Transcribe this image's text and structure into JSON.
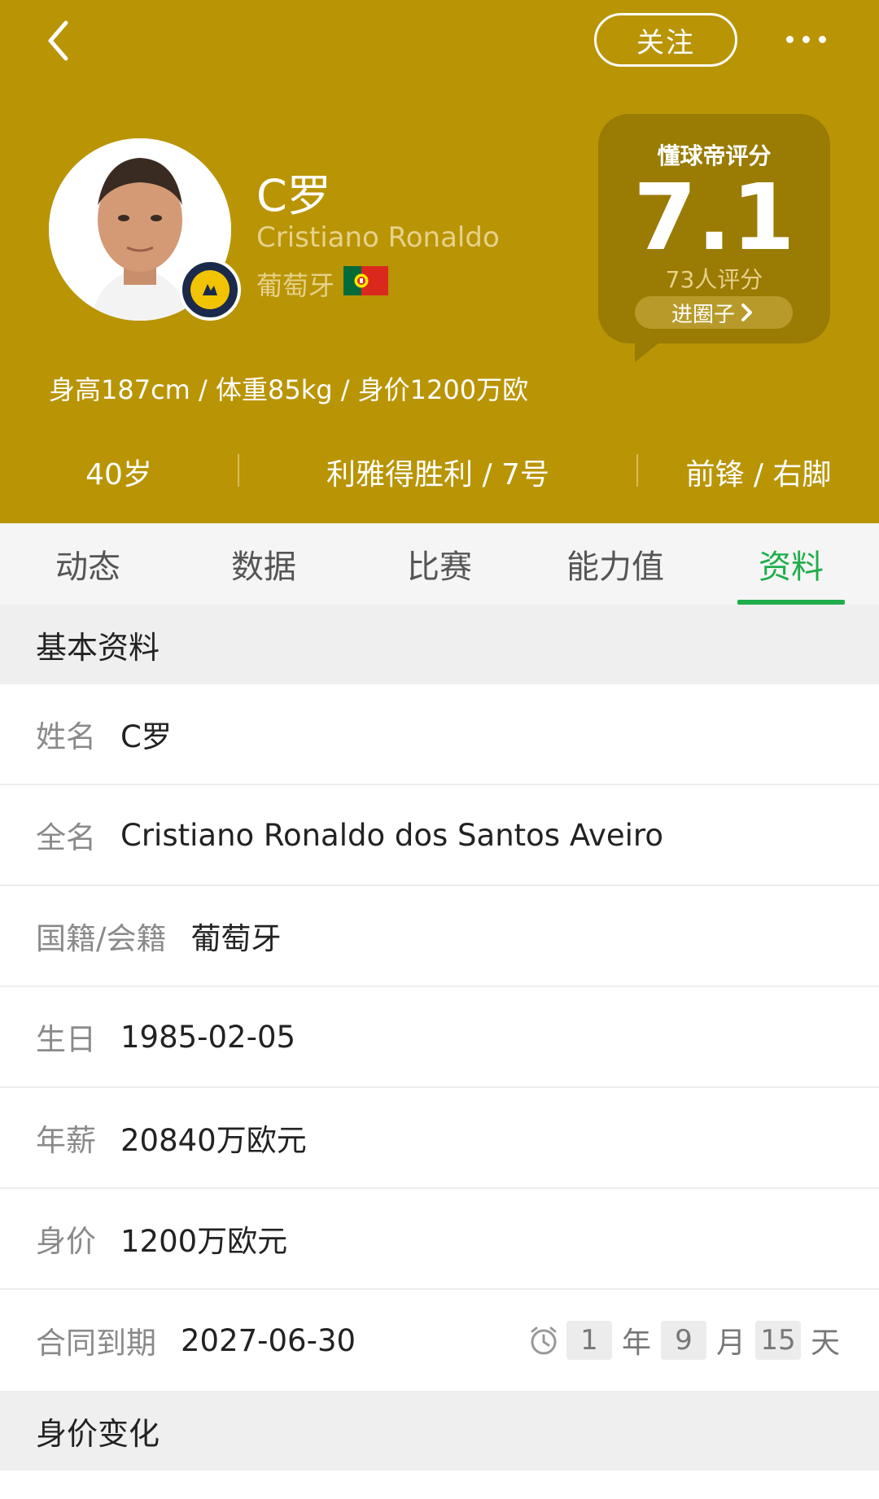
{
  "header": {
    "follow_label": "关注",
    "player_name": "C罗",
    "player_name_en": "Cristiano Ronaldo",
    "nationality": "葡萄牙",
    "stats_line": "身高187cm / 体重85kg / 身价1200万欧",
    "age": "40岁",
    "club_number": "利雅得胜利 / 7号",
    "position_foot": "前锋 / 右脚",
    "colors": {
      "background": "#b99405",
      "rating_card": "#9a7b03"
    }
  },
  "rating": {
    "title": "懂球帝评分",
    "value": "7.1",
    "count": "73人评分",
    "circle_button": "进圈子"
  },
  "tabs": [
    {
      "label": "动态",
      "active": false
    },
    {
      "label": "数据",
      "active": false
    },
    {
      "label": "比赛",
      "active": false
    },
    {
      "label": "能力值",
      "active": false
    },
    {
      "label": "资料",
      "active": true
    }
  ],
  "profile": {
    "section_title": "基本资料",
    "rows": [
      {
        "label": "姓名",
        "value": "C罗"
      },
      {
        "label": "全名",
        "value": "Cristiano Ronaldo dos Santos Aveiro"
      },
      {
        "label": "国籍/会籍",
        "value": "葡萄牙"
      },
      {
        "label": "生日",
        "value": "1985-02-05"
      },
      {
        "label": "年薪",
        "value": "20840万欧元"
      },
      {
        "label": "身价",
        "value": "1200万欧元"
      }
    ],
    "contract": {
      "label": "合同到期",
      "value": "2027-06-30",
      "countdown": {
        "years": "1",
        "year_unit": "年",
        "months": "9",
        "month_unit": "月",
        "days": "15",
        "day_unit": "天"
      }
    }
  },
  "value_section": {
    "title": "身价变化"
  },
  "accent_color": "#1fae4b"
}
